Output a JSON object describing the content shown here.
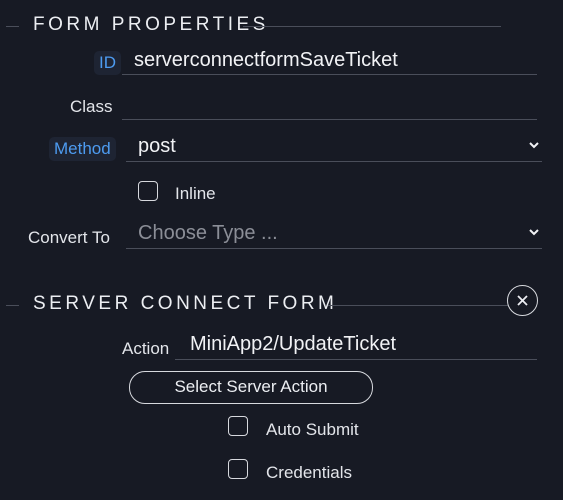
{
  "form_properties": {
    "title": "FORM PROPERTIES",
    "id": {
      "label": "ID",
      "value": "serverconnectformSaveTicket"
    },
    "class": {
      "label": "Class",
      "value": ""
    },
    "method": {
      "label": "Method",
      "value": "post",
      "icon": "chevron-down-icon"
    },
    "inline": {
      "label": "Inline",
      "checked": false
    },
    "convert_to": {
      "label": "Convert To",
      "placeholder": "Choose Type ...",
      "icon": "chevron-down-icon"
    }
  },
  "server_connect_form": {
    "title": "SERVER CONNECT FORM",
    "close_icon": "close-circle-icon",
    "action": {
      "label": "Action",
      "value": "MiniApp2/UpdateTicket"
    },
    "select_button": "Select Server Action",
    "auto_submit": {
      "label": "Auto Submit",
      "checked": false
    },
    "credentials": {
      "label": "Credentials",
      "checked": false
    }
  },
  "colors": {
    "background": "#171a24",
    "accent_blue": "#4d9bf0",
    "rule": "#4a4e5a"
  }
}
